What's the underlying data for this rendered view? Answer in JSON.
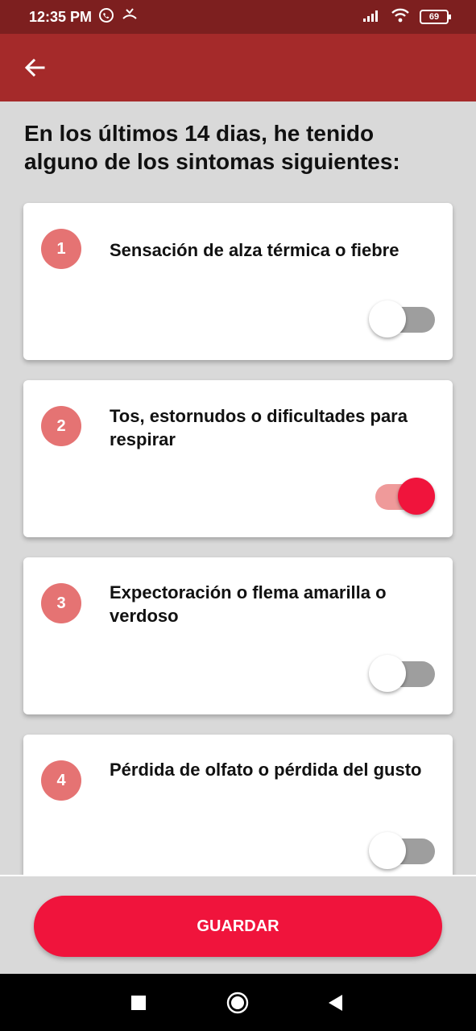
{
  "status_bar": {
    "time": "12:35 PM",
    "battery": "69"
  },
  "question": "En los últimos 14 dias, he tenido alguno de los sintomas siguientes:",
  "symptoms": [
    {
      "number": "1",
      "label": "Sensación de alza térmica o fiebre",
      "checked": false
    },
    {
      "number": "2",
      "label": "Tos, estornudos o dificultades para respirar",
      "checked": true
    },
    {
      "number": "3",
      "label": "Expectoración o flema amarilla o verdoso",
      "checked": false
    },
    {
      "number": "4",
      "label": "Pérdida de olfato o pérdida del gusto",
      "checked": false
    }
  ],
  "save_button": "GUARDAR",
  "icons": {
    "back": "arrow-back-icon",
    "whatsapp": "whatsapp-icon",
    "missed_call": "missed-call-icon",
    "signal": "signal-icon",
    "wifi": "wifi-icon",
    "battery": "battery-icon",
    "recents": "square-icon",
    "home": "circle-icon",
    "back_nav": "triangle-back-icon"
  },
  "colors": {
    "status_bar": "#7d1f1f",
    "app_bar": "#a52a2a",
    "accent": "#f0143c",
    "badge": "#e57373"
  }
}
